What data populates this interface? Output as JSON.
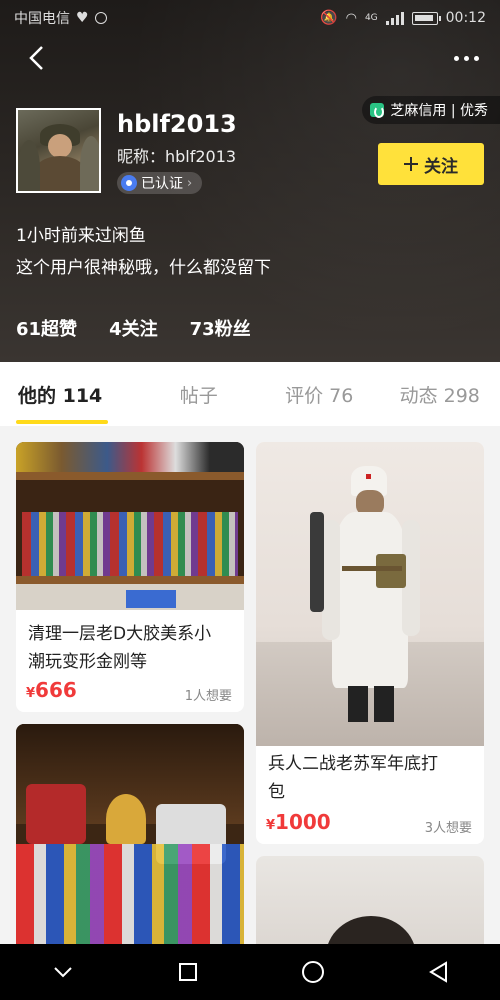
{
  "status_bar": {
    "carrier": "中国电信",
    "network": "4G",
    "time": "00:12"
  },
  "profile": {
    "username": "hblf2013",
    "nickname_label": "昵称：hblf2013",
    "verified_label": "已认证",
    "follow_label": "关注",
    "sesame_label": "芝麻信用 | 优秀",
    "last_seen": "1小时前来过闲鱼",
    "bio": "这个用户很神秘哦，什么都没留下",
    "stats": [
      "61超赞",
      "4关注",
      "73粉丝"
    ]
  },
  "tabs": [
    {
      "label": "他的 114",
      "active": true
    },
    {
      "label": "帖子",
      "active": false
    },
    {
      "label": "评价 76",
      "active": false
    },
    {
      "label": "动态 298",
      "active": false
    }
  ],
  "listings": [
    {
      "title_line1": "清理一层老D大胶美系小",
      "title_line2": "潮玩变形金刚等",
      "currency": "¥",
      "price": "666",
      "wants": "1人想要"
    },
    {
      "title_line1": "兵人二战老苏军年底打",
      "title_line2": "包",
      "currency": "¥",
      "price": "1000",
      "wants": "3人想要"
    }
  ],
  "colors": {
    "accent_yellow": "#ffe033",
    "price_red": "#f03a3a",
    "sesame_green": "#1fc07e"
  },
  "icons": {
    "back": "back-arrow-icon",
    "more": "more-dots-icon",
    "nav": [
      "chevron-down-icon",
      "square-icon",
      "circle-icon",
      "triangle-back-icon"
    ]
  }
}
